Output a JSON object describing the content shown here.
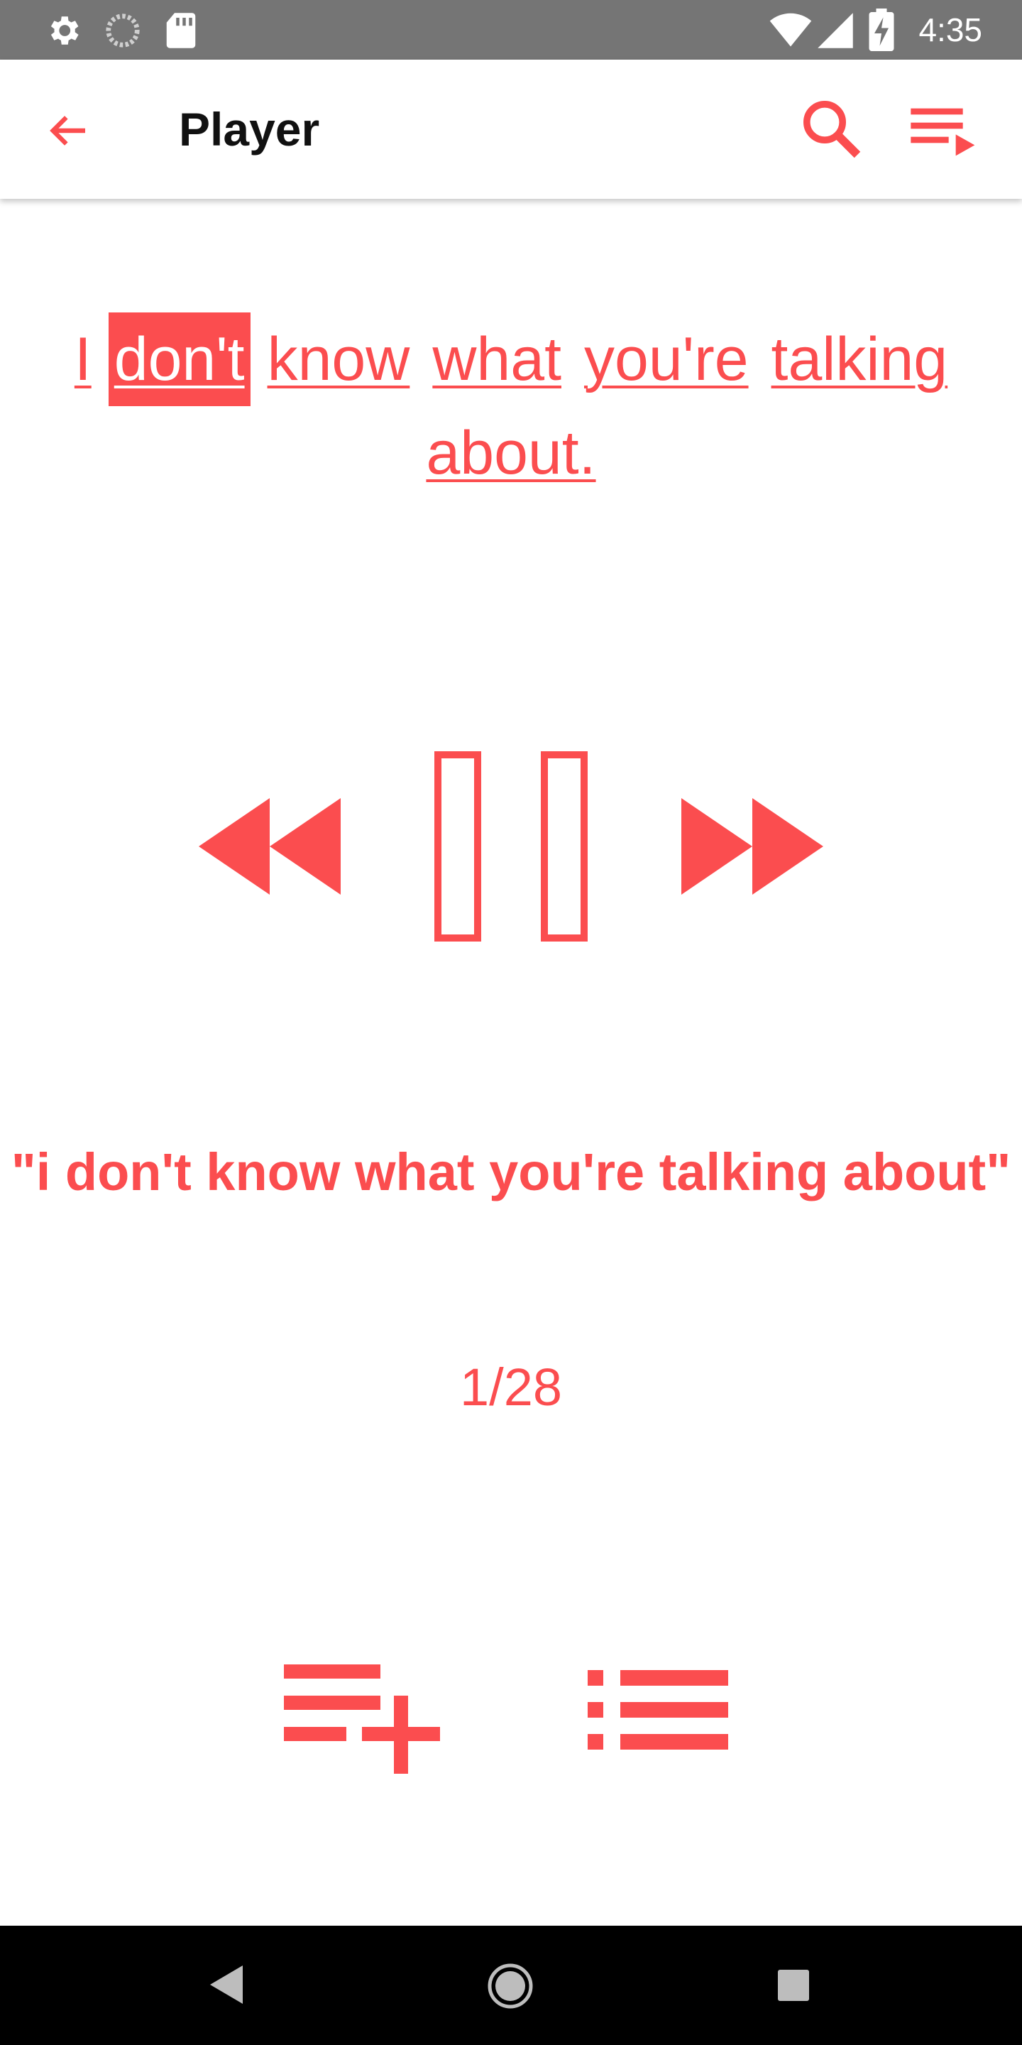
{
  "status_bar": {
    "time": "4:35",
    "icons": [
      "gear-icon",
      "sync-icon",
      "sd-card-icon",
      "wifi-icon",
      "signal-icon",
      "battery-charging-icon"
    ]
  },
  "app_bar": {
    "title": "Player",
    "back_icon": "arrow-back-icon",
    "search_icon": "search-icon",
    "queue_icon": "queue-music-icon"
  },
  "lyric": {
    "words": [
      "I",
      "don't",
      "know",
      "what",
      "you're",
      "talking",
      "about."
    ],
    "active_index": 1
  },
  "controls": {
    "rewind_icon": "rewind-icon",
    "pause_icon": "pause-icon",
    "fast_forward_icon": "fast-forward-icon"
  },
  "phrase": "\"i don't know what you're talking about\"",
  "counter": "1/28",
  "bottom_actions": {
    "add_to_playlist_icon": "playlist-add-icon",
    "list_icon": "list-icon"
  },
  "colors": {
    "accent": "#fb4d4f",
    "status_bar": "#757575",
    "nav_bar": "#000000"
  }
}
